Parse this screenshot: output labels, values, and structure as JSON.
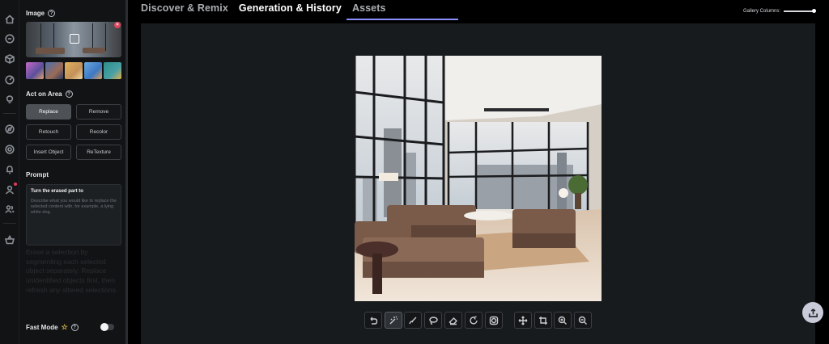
{
  "nav": {
    "tabs": [
      {
        "label": "Discover & Remix"
      },
      {
        "label": "Generation & History"
      },
      {
        "label": "Assets"
      }
    ],
    "gallery_columns_label": "Gallery Columns:"
  },
  "panel": {
    "image_label": "Image",
    "act_on_area_label": "Act on Area",
    "actions": [
      {
        "label": "Replace",
        "active": true
      },
      {
        "label": "Remove",
        "active": false
      },
      {
        "label": "Retouch",
        "active": false
      },
      {
        "label": "Recolor",
        "active": false
      },
      {
        "label": "Insert Object",
        "active": false
      },
      {
        "label": "ReTexture",
        "active": false
      }
    ],
    "prompt_label": "Prompt",
    "prompt_title": "Turn the erased part to",
    "prompt_placeholder": "Describe what you would like to replace the selected content with, for example, a lying white dog.",
    "help_text": "Erase a selection by segmenting each selected object separately. Replace unidentified objects first, then refresh any altered selections.",
    "fast_mode_label": "Fast Mode",
    "fast_mode_on": false
  },
  "toolbar": {
    "tools": [
      "undo-icon",
      "magic-select-icon",
      "brush-icon",
      "lasso-icon",
      "eraser-icon",
      "redo-icon",
      "mask-icon",
      "move-icon",
      "crop-icon",
      "zoom-in-icon",
      "zoom-out-icon"
    ]
  },
  "colors": {
    "accent": "#8a8fff",
    "badge": "#e0455e",
    "star": "#e6c14b"
  }
}
